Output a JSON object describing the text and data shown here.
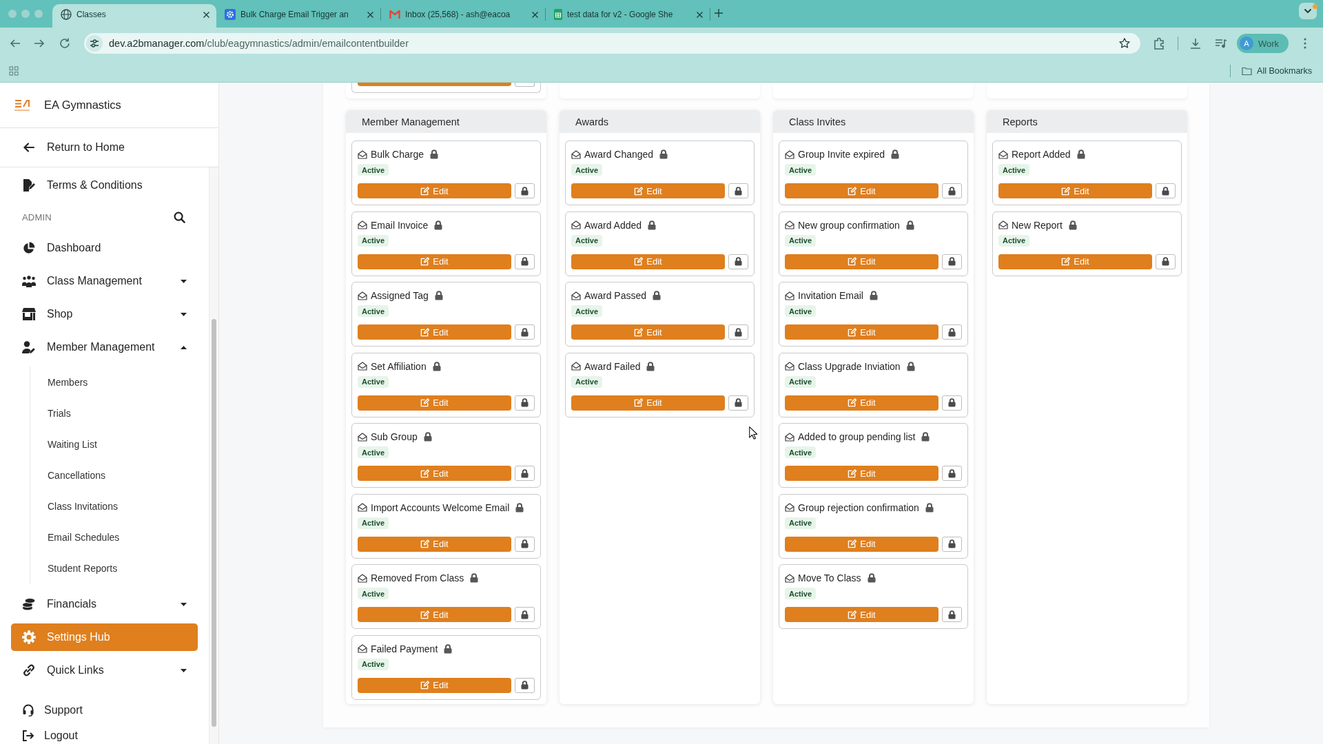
{
  "browser": {
    "tabs": [
      {
        "title": "Classes",
        "selected": true
      },
      {
        "title": "Bulk Charge Email Trigger an",
        "selected": false
      },
      {
        "title": "Inbox (25,568) - ash@eacoa",
        "selected": false
      },
      {
        "title": "test data for v2 - Google She",
        "selected": false
      }
    ],
    "address": {
      "host": "dev.a2bmanager.com",
      "path": "/club/eagymnastics/admin/emailcontentbuilder"
    },
    "profile": {
      "initial": "A",
      "label": "Work"
    },
    "bookmarks_folder": "All Bookmarks"
  },
  "sidebar": {
    "brand": "EA Gymnastics",
    "return_link": "Return to Home",
    "pinned_link": "Terms & Conditions",
    "section_label": "ADMIN",
    "nav": [
      {
        "label": "Dashboard",
        "kind": "link",
        "selected": false
      },
      {
        "label": "Class Management",
        "kind": "group",
        "expanded": false,
        "selected": false
      },
      {
        "label": "Shop",
        "kind": "group",
        "expanded": false,
        "selected": false
      },
      {
        "label": "Member Management",
        "kind": "group",
        "expanded": true,
        "selected": false,
        "children": [
          {
            "label": "Members",
            "selected": false
          },
          {
            "label": "Trials",
            "selected": false
          },
          {
            "label": "Waiting List",
            "selected": false
          },
          {
            "label": "Cancellations",
            "selected": false
          },
          {
            "label": "Class Invitations",
            "selected": false
          },
          {
            "label": "Email Schedules",
            "selected": false
          },
          {
            "label": "Student Reports",
            "selected": false
          }
        ]
      },
      {
        "label": "Financials",
        "kind": "group",
        "expanded": false,
        "selected": false
      },
      {
        "label": "Settings Hub",
        "kind": "link",
        "selected": true
      },
      {
        "label": "Quick Links",
        "kind": "group",
        "expanded": false,
        "selected": false
      }
    ],
    "footer_links": [
      {
        "label": "Support"
      },
      {
        "label": "Logout"
      }
    ]
  },
  "template_groups": [
    {
      "title": "Member Management",
      "templates": [
        {
          "name": "Bulk Charge",
          "locked": true,
          "status": "Active",
          "edit_label": "Edit"
        },
        {
          "name": "Email Invoice",
          "locked": true,
          "status": "Active",
          "edit_label": "Edit"
        },
        {
          "name": "Assigned Tag",
          "locked": true,
          "status": "Active",
          "edit_label": "Edit"
        },
        {
          "name": "Set Affiliation",
          "locked": true,
          "status": "Active",
          "edit_label": "Edit"
        },
        {
          "name": "Sub Group",
          "locked": true,
          "status": "Active",
          "edit_label": "Edit"
        },
        {
          "name": "Import Accounts Welcome Email",
          "locked": true,
          "status": "Active",
          "edit_label": "Edit"
        },
        {
          "name": "Removed From Class",
          "locked": true,
          "status": "Active",
          "edit_label": "Edit"
        },
        {
          "name": "Failed Payment",
          "locked": true,
          "status": "Active",
          "edit_label": "Edit"
        }
      ]
    },
    {
      "title": "Awards",
      "templates": [
        {
          "name": "Award Changed",
          "locked": true,
          "status": "Active",
          "edit_label": "Edit"
        },
        {
          "name": "Award Added",
          "locked": true,
          "status": "Active",
          "edit_label": "Edit"
        },
        {
          "name": "Award Passed",
          "locked": true,
          "status": "Active",
          "edit_label": "Edit"
        },
        {
          "name": "Award Failed",
          "locked": true,
          "status": "Active",
          "edit_label": "Edit"
        }
      ]
    },
    {
      "title": "Class Invites",
      "templates": [
        {
          "name": "Group Invite expired",
          "locked": true,
          "status": "Active",
          "edit_label": "Edit"
        },
        {
          "name": "New group confirmation",
          "locked": true,
          "status": "Active",
          "edit_label": "Edit"
        },
        {
          "name": "Invitation Email",
          "locked": true,
          "status": "Active",
          "edit_label": "Edit"
        },
        {
          "name": "Class Upgrade Inviation",
          "locked": true,
          "status": "Active",
          "edit_label": "Edit"
        },
        {
          "name": "Added to group pending list",
          "locked": true,
          "status": "Active",
          "edit_label": "Edit"
        },
        {
          "name": "Group rejection confirmation",
          "locked": true,
          "status": "Active",
          "edit_label": "Edit"
        },
        {
          "name": "Move To Class",
          "locked": true,
          "status": "Active",
          "edit_label": "Edit"
        }
      ]
    },
    {
      "title": "Reports",
      "templates": [
        {
          "name": "Report Added",
          "locked": true,
          "status": "Active",
          "edit_label": "Edit"
        },
        {
          "name": "New Report",
          "locked": true,
          "status": "Active",
          "edit_label": "Edit"
        }
      ]
    }
  ]
}
